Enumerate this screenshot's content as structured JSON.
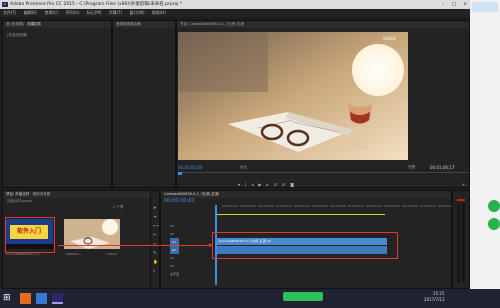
{
  "window": {
    "title": "Adobe Premiere Pro CC 2015 - C:\\Program Files (x86)\\外接剪辑\\未命名.prproj *",
    "app_icon": "Pr"
  },
  "menu": [
    "文件(F)",
    "编辑(E)",
    "剪辑(C)",
    "序列(S)",
    "标记(M)",
    "字幕(T)",
    "窗口(W)",
    "帮助(H)"
  ],
  "source_panel": {
    "tabs": [
      "源:(无剪辑)",
      "效果控件",
      "音频剪辑混合器:"
    ],
    "message": "(未选定剪辑)"
  },
  "program_panel": {
    "title": "节目: Comodo800636-0-1_7比例_红酒",
    "watermark": "VIGEO",
    "timecode_left": "00;00;00;00",
    "fit": "适合",
    "ratio": "完整",
    "timecode_right": "00;01;06;17"
  },
  "project_panel": {
    "tabs": [
      "项目: 外接点材",
      "媒体浏览器"
    ],
    "file": "外接点材.prproj",
    "item_count": "2 个项",
    "items": [
      {
        "name": "Comodo800636-0-1_7...",
        "duration": "1;06;17",
        "thumb_text": "软件入门"
      },
      {
        "name": "VIDEO01 ...",
        "duration": "1;06;17"
      }
    ]
  },
  "timeline": {
    "tab": "Comodo800636-0-1_7比例_红酒",
    "timecode": "00;00;00;00",
    "ruler": [
      "00;00;04;29",
      "00;00;09;29",
      "00;00;14;29",
      "00;00;19;29",
      "00;00;24;29",
      "00;00;29;29",
      "00;00;34;28",
      "00;00;39;29",
      "00;00;44;29",
      "00;00;49;29",
      "00;00;54;29",
      "00;00;59;29",
      "00;01;04;29"
    ],
    "tracks": [
      "V3",
      "V2",
      "V1",
      "A1",
      "A2",
      "A3",
      "主声道"
    ],
    "clip_label": "Comodo800636-0-1_7比例_红酒 [V]"
  },
  "taskbar": {
    "time": "15:25",
    "date": "2017/7/13"
  },
  "colors": {
    "accent": "#3a8ee6",
    "highlight": "#e8352f",
    "clip": "#4a8ad0"
  }
}
